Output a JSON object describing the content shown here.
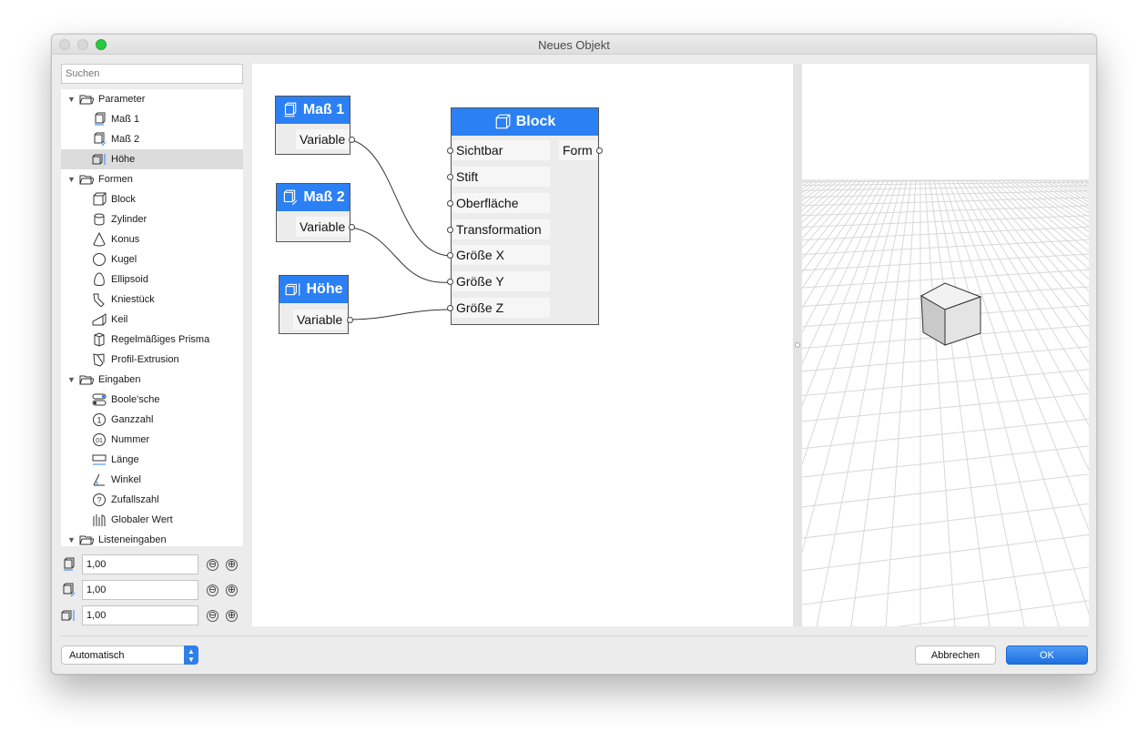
{
  "window": {
    "title": "Neues Objekt"
  },
  "sidebar": {
    "search_placeholder": "Suchen",
    "groups": [
      {
        "label": "Parameter",
        "icon": "folder-icon",
        "items": [
          {
            "label": "Maß 1",
            "icon": "dimension-1-icon"
          },
          {
            "label": "Maß 2",
            "icon": "dimension-2-icon"
          },
          {
            "label": "Höhe",
            "icon": "height-icon",
            "selected": true
          }
        ]
      },
      {
        "label": "Formen",
        "icon": "folder-icon",
        "items": [
          {
            "label": "Block",
            "icon": "block-icon"
          },
          {
            "label": "Zylinder",
            "icon": "cylinder-icon"
          },
          {
            "label": "Konus",
            "icon": "cone-icon"
          },
          {
            "label": "Kugel",
            "icon": "sphere-icon"
          },
          {
            "label": "Ellipsoid",
            "icon": "ellipsoid-icon"
          },
          {
            "label": "Kniestück",
            "icon": "elbow-icon"
          },
          {
            "label": "Keil",
            "icon": "wedge-icon"
          },
          {
            "label": "Regelmäßiges Prisma",
            "icon": "prism-icon"
          },
          {
            "label": "Profil-Extrusion",
            "icon": "extrusion-icon"
          }
        ]
      },
      {
        "label": "Eingaben",
        "icon": "folder-icon",
        "items": [
          {
            "label": "Boole'sche",
            "icon": "boolean-icon"
          },
          {
            "label": "Ganzzahl",
            "icon": "integer-icon"
          },
          {
            "label": "Nummer",
            "icon": "number-icon"
          },
          {
            "label": "Länge",
            "icon": "length-icon"
          },
          {
            "label": "Winkel",
            "icon": "angle-icon"
          },
          {
            "label": "Zufallszahl",
            "icon": "random-icon"
          },
          {
            "label": "Globaler Wert",
            "icon": "global-value-icon"
          }
        ]
      },
      {
        "label": "Listeneingaben",
        "icon": "folder-icon",
        "items": []
      }
    ]
  },
  "params": [
    {
      "icon": "dimension-1-icon",
      "value": "1,00",
      "minus": "⊖",
      "plus": "⊕"
    },
    {
      "icon": "dimension-2-icon",
      "value": "1,00",
      "minus": "⊖",
      "plus": "⊕"
    },
    {
      "icon": "height-icon",
      "value": "1,00",
      "minus": "⊖",
      "plus": "⊕"
    }
  ],
  "nodes": {
    "mass1": {
      "title": "Maß 1",
      "output": "Variable"
    },
    "mass2": {
      "title": "Maß 2",
      "output": "Variable"
    },
    "hoehe": {
      "title": "Höhe",
      "output": "Variable"
    },
    "block": {
      "title": "Block",
      "inputs": [
        "Sichtbar",
        "Stift",
        "Oberfläche",
        "Transformation",
        "Größe X",
        "Größe Y",
        "Größe Z"
      ],
      "output": "Form"
    }
  },
  "footer": {
    "mode_select": "Automatisch",
    "cancel_label": "Abbrechen",
    "ok_label": "OK"
  },
  "colors": {
    "accent": "#2b80f4",
    "ok_button": "#1e6fe0",
    "traffic_green": "#2ac940"
  }
}
